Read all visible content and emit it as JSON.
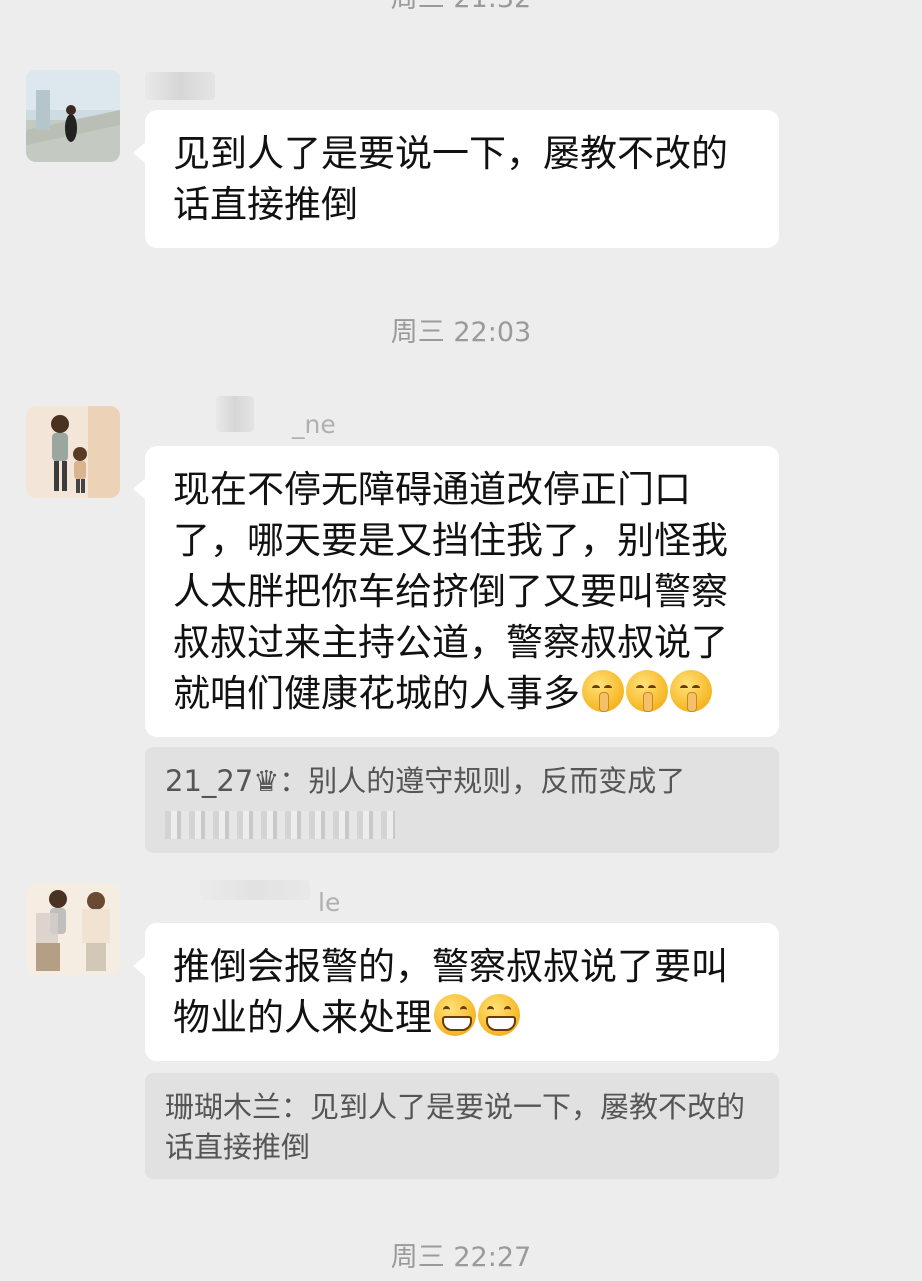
{
  "timestamps": [
    "周三 21:32",
    "周三 22:03",
    "周三 22:27"
  ],
  "messages": [
    {
      "nickname": "",
      "text": "见到人了是要说一下，屡教不改的话直接推倒"
    },
    {
      "nickname": "_ne",
      "text": "现在不停无障碍通道改停正门口了，哪天要是又挡住我了，别怪我人太胖把你车给挤倒了又要叫警察叔叔过来主持公道，警察叔叔说了就咱们健康花城的人事多",
      "emojis": [
        "shushing-face",
        "shushing-face",
        "shushing-face"
      ],
      "quote": {
        "text": "21_27♛：别人的遵守规则，反而变成了"
      }
    },
    {
      "nickname": "le",
      "text": "推倒会报警的，警察叔叔说了要叫物业的人来处理",
      "emojis": [
        "grinning-face",
        "grinning-face"
      ],
      "quote": {
        "text": "珊瑚木兰：见到人了是要说一下，屡教不改的话直接推倒"
      }
    }
  ]
}
